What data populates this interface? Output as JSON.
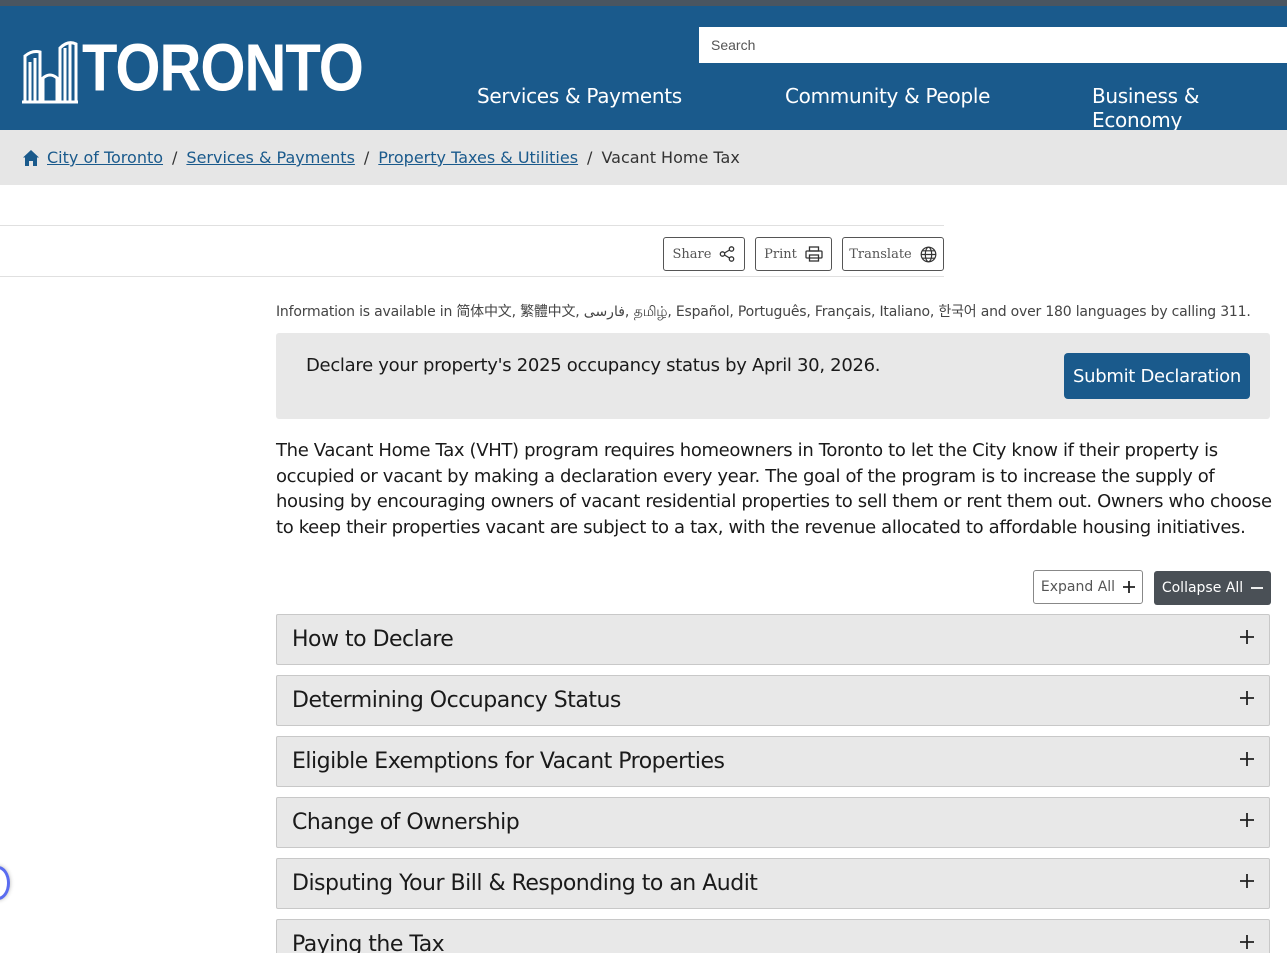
{
  "header": {
    "logo_text": "TORONTO",
    "search_placeholder": "Search",
    "nav": [
      "Services & Payments",
      "Community & People",
      "Business & Economy"
    ]
  },
  "breadcrumb": {
    "items": [
      "City of Toronto",
      "Services & Payments",
      "Property Taxes & Utilities"
    ],
    "separator": "/",
    "current": "Vacant Home Tax"
  },
  "toolbar": {
    "share": "Share",
    "print": "Print",
    "translate": "Translate"
  },
  "lang_info": "Information is available in 简体中文, 繁體中文, فارسی, தமிழ், Español, Português, Français, Italiano, 한국어 and over 180 languages by calling 311.",
  "notice": {
    "text": "Declare your property's 2025 occupancy status by April 30, 2026.",
    "button": "Submit Declaration"
  },
  "intro": "The Vacant Home Tax (VHT) program requires homeowners in Toronto to let the City know if their property is occupied or vacant by making a declaration every year. The goal of the program is to increase the supply of housing by encouraging owners of vacant residential properties to sell them or rent them out. Owners who choose to keep their properties vacant are subject to a tax, with the revenue allocated to affordable housing initiatives.",
  "accordion_controls": {
    "expand": "Expand All",
    "collapse": "Collapse All"
  },
  "accordion": [
    "How to Declare",
    "Determining Occupancy Status",
    "Eligible Exemptions for Vacant Properties",
    "Change of Ownership",
    "Disputing Your Bill & Responding to an Audit",
    "Paying the Tax"
  ],
  "colors": {
    "brand_blue": "#1a5a8c",
    "panel_gray": "#e8e8e8",
    "dark_button": "#4a5056"
  }
}
